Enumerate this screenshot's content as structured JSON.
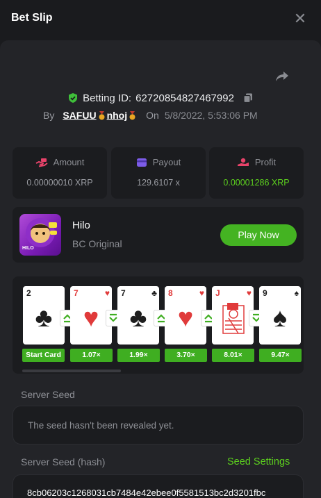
{
  "header": {
    "title": "Bet Slip",
    "close_icon": "close-icon"
  },
  "bet": {
    "id_label": "Betting ID:",
    "id": "62720854827467992",
    "by_label": "By",
    "user_name_a": "SAFUU",
    "user_name_b": "nhoj",
    "on_label": "On",
    "date": "5/8/2022, 5:53:06 PM"
  },
  "stats": {
    "amount": {
      "label": "Amount",
      "value": "0.00000010 XRP",
      "icon": "money-hand-icon"
    },
    "payout": {
      "label": "Payout",
      "value": "129.6107 x",
      "icon": "card-wallet-icon"
    },
    "profit": {
      "label": "Profit",
      "value": "0.00001286 XRP",
      "icon": "profit-hand-icon"
    }
  },
  "game": {
    "name": "Hilo",
    "subtitle": "BC Original",
    "thumb_label": "HILO",
    "play_label": "Play Now"
  },
  "cards": [
    {
      "rank": "2",
      "suit": "♣",
      "color": "black",
      "mult": "Start Card",
      "arrow": ""
    },
    {
      "rank": "7",
      "suit": "♥",
      "color": "red",
      "mult": "1.07×",
      "arrow": "up"
    },
    {
      "rank": "7",
      "suit": "♣",
      "color": "black",
      "mult": "1.99×",
      "arrow": "down"
    },
    {
      "rank": "8",
      "suit": "♥",
      "color": "red",
      "mult": "3.70×",
      "arrow": "up"
    },
    {
      "rank": "J",
      "suit": "♥",
      "color": "red",
      "mult": "8.01×",
      "arrow": "up"
    },
    {
      "rank": "9",
      "suit": "♠",
      "color": "black",
      "mult": "9.47×",
      "arrow": "down"
    }
  ],
  "server_seed": {
    "label": "Server Seed",
    "value": "The seed hasn't been revealed yet."
  },
  "server_seed_hash": {
    "label": "Server Seed (hash)",
    "settings_label": "Seed Settings",
    "value": "8cb06203c1268031cb7484e42ebee0f5581513bc2d3201fbc"
  },
  "colors": {
    "accent_green": "#44b322",
    "profit_green": "#5ccf1e",
    "background": "#1a1b1e",
    "panel": "#232428"
  }
}
